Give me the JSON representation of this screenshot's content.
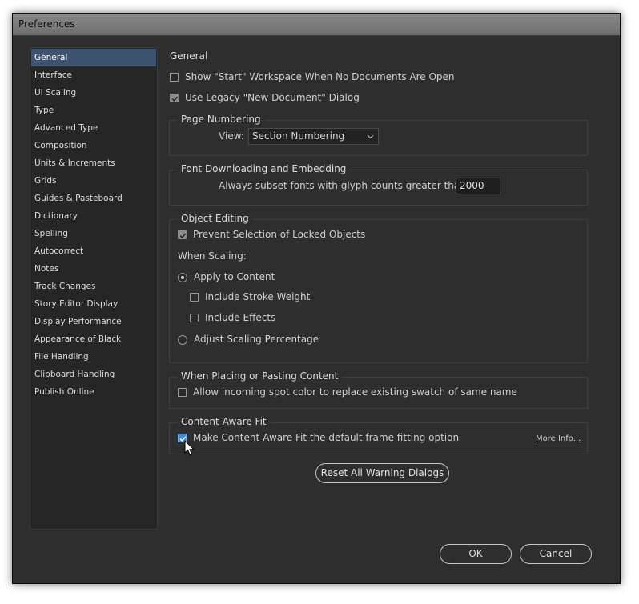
{
  "window": {
    "title": "Preferences"
  },
  "sidebar": {
    "items": [
      {
        "label": "General",
        "selected": true
      },
      {
        "label": "Interface"
      },
      {
        "label": "UI Scaling"
      },
      {
        "label": "Type"
      },
      {
        "label": "Advanced Type"
      },
      {
        "label": "Composition"
      },
      {
        "label": "Units & Increments"
      },
      {
        "label": "Grids"
      },
      {
        "label": "Guides & Pasteboard"
      },
      {
        "label": "Dictionary"
      },
      {
        "label": "Spelling"
      },
      {
        "label": "Autocorrect"
      },
      {
        "label": "Notes"
      },
      {
        "label": "Track Changes"
      },
      {
        "label": "Story Editor Display"
      },
      {
        "label": "Display Performance"
      },
      {
        "label": "Appearance of Black"
      },
      {
        "label": "File Handling"
      },
      {
        "label": "Clipboard Handling"
      },
      {
        "label": "Publish Online"
      }
    ]
  },
  "main": {
    "heading": "General",
    "show_start_workspace": {
      "label": "Show \"Start\" Workspace When No Documents Are Open",
      "checked": false
    },
    "use_legacy_new_document": {
      "label": "Use Legacy \"New Document\" Dialog",
      "checked": true
    },
    "page_numbering": {
      "title": "Page Numbering",
      "view_label": "View:",
      "view_value": "Section Numbering"
    },
    "font_downloading": {
      "title": "Font Downloading and Embedding",
      "subset_label": "Always subset fonts with glyph counts greater than:",
      "subset_value": "2000"
    },
    "object_editing": {
      "title": "Object Editing",
      "prevent_selection": {
        "label": "Prevent Selection of Locked Objects",
        "checked": true
      },
      "when_scaling_label": "When Scaling:",
      "apply_to_content": {
        "label": "Apply to Content",
        "selected": true
      },
      "include_stroke_weight": {
        "label": "Include Stroke Weight",
        "checked": false
      },
      "include_effects": {
        "label": "Include Effects",
        "checked": false
      },
      "adjust_scaling": {
        "label": "Adjust Scaling Percentage",
        "selected": false
      }
    },
    "placing_pasting": {
      "title": "When Placing or Pasting Content",
      "allow_spot_color": {
        "label": "Allow incoming spot color to replace existing swatch of same name",
        "checked": false
      }
    },
    "content_aware_fit": {
      "title": "Content-Aware Fit",
      "make_default": {
        "label": "Make Content-Aware Fit the default frame fitting option",
        "checked": true
      },
      "more_info": "More Info..."
    },
    "reset_warning_button": "Reset All Warning Dialogs"
  },
  "footer": {
    "ok_label": "OK",
    "cancel_label": "Cancel"
  },
  "colors": {
    "accent_selected": "#3d5470",
    "checkbox_blue": "#3d8be0",
    "background": "#2e2e2e"
  }
}
